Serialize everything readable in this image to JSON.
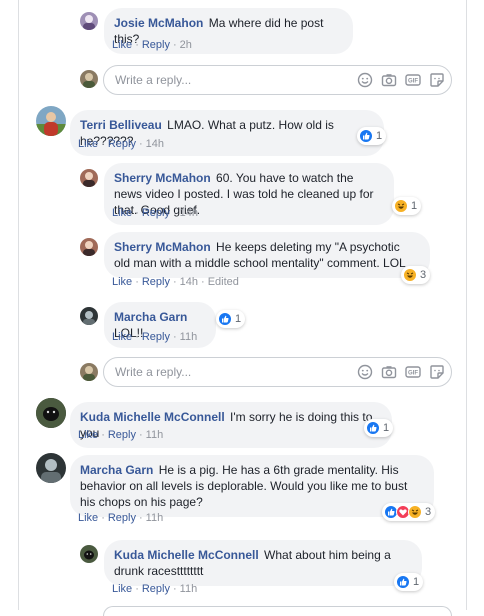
{
  "colors": {
    "link": "#385898",
    "meta": "#90949c",
    "bubble": "#f2f3f5",
    "like": "#1877f2",
    "love": "#f33e58",
    "haha": "#f7b125"
  },
  "actions": {
    "like": "Like",
    "reply": "Reply",
    "sep": "·",
    "edited": "Edited"
  },
  "reply_box": {
    "placeholder": "Write a reply..."
  },
  "comments": [
    {
      "name": "Josie McMahon",
      "text": "Ma where did he post this?",
      "time": "2h"
    },
    {
      "name": "Terri Belliveau",
      "text": "LMAO. What a putz. How old is he??????",
      "time": "14h",
      "reactions": "1"
    },
    {
      "name": "Sherry McMahon",
      "text": "60. You have to watch the news video I posted. I was told he cleaned up for that. Good grief.",
      "time": "14h",
      "reactions": "1"
    },
    {
      "name": "Sherry McMahon",
      "text": "He keeps deleting my \"A psychotic old man with a middle school mentality\" comment. LOL",
      "time": "14h",
      "reactions": "3"
    },
    {
      "name": "Marcha Garn",
      "text": "LOL!!",
      "time": "11h",
      "reactions": "1"
    },
    {
      "name": "Kuda Michelle McConnell",
      "text": "I'm sorry he is doing this to you",
      "time": "11h",
      "reactions": "1"
    },
    {
      "name": "Marcha Garn",
      "text": "He is a pig. He has a 6th grade mentality. His behavior on all levels is deplorable. Would you like me to bust his chops on his page?",
      "time": "11h",
      "reactions": "3"
    },
    {
      "name": "Kuda Michelle McConnell",
      "text": "What about him being a drunk racestttttttt",
      "time": "11h",
      "reactions": "1"
    }
  ],
  "toolbar_icons": [
    "emoji-icon",
    "camera-icon",
    "gif-icon",
    "sticker-icon"
  ]
}
